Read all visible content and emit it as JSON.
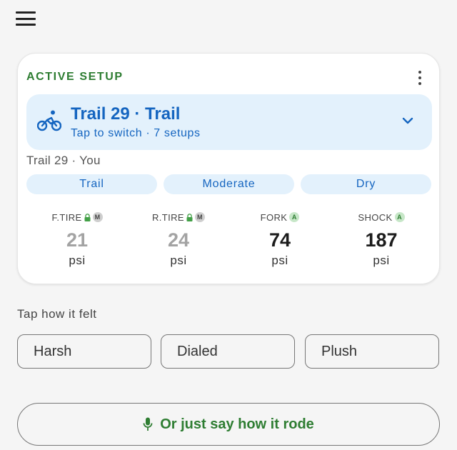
{
  "colors": {
    "background": "#f5f5f5",
    "card": "#ffffff",
    "accent_green": "#2e7d32",
    "accent_blue": "#1565c0",
    "chip_background": "#e3f1fc",
    "muted_value": "#a3a3a3"
  },
  "toolbar": {
    "menu_icon": "hamburger-menu-icon"
  },
  "active_setup": {
    "heading": "ACTIVE SETUP",
    "more_icon": "more-vertical-icon",
    "selector": {
      "icon": "bicycle-icon",
      "name": "Trail 29 · Trail",
      "subtitle": "Tap to switch · 7 setups",
      "chevron_icon": "chevron-down-icon"
    },
    "owner_line": "Trail 29 · You",
    "chips": [
      "Trail",
      "Moderate",
      "Dry"
    ],
    "pressures": [
      {
        "label": "F.TIRE",
        "locked": true,
        "mode": "M",
        "value": "21",
        "unit": "psi",
        "emphasis": "muted"
      },
      {
        "label": "R.TIRE",
        "locked": true,
        "mode": "M",
        "value": "24",
        "unit": "psi",
        "emphasis": "muted"
      },
      {
        "label": "FORK",
        "locked": false,
        "mode": "A",
        "value": "74",
        "unit": "psi",
        "emphasis": "strong"
      },
      {
        "label": "SHOCK",
        "locked": false,
        "mode": "A",
        "value": "187",
        "unit": "psi",
        "emphasis": "strong"
      }
    ]
  },
  "feedback": {
    "prompt": "Tap how it felt",
    "options": [
      "Harsh",
      "Dialed",
      "Plush"
    ]
  },
  "voice": {
    "icon": "microphone-icon",
    "label": "Or just say how it rode"
  }
}
